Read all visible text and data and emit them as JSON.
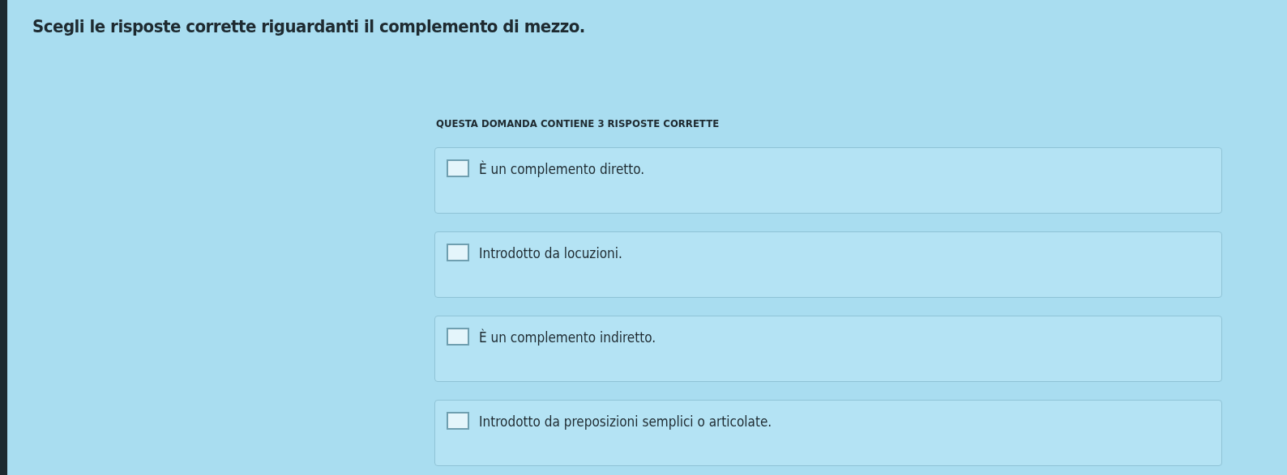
{
  "question": {
    "title": "Scegli le risposte corrette riguardanti il complemento di mezzo.",
    "instruction": "QUESTA DOMANDA CONTIENE 3 RISPOSTE CORRETTE"
  },
  "answers": [
    {
      "label": "È un complemento diretto.",
      "checked": false
    },
    {
      "label": "Introdotto da locuzioni.",
      "checked": false
    },
    {
      "label": "È un complemento indiretto.",
      "checked": false
    },
    {
      "label": "Introdotto da preposizioni semplici o articolate.",
      "checked": false
    }
  ]
}
